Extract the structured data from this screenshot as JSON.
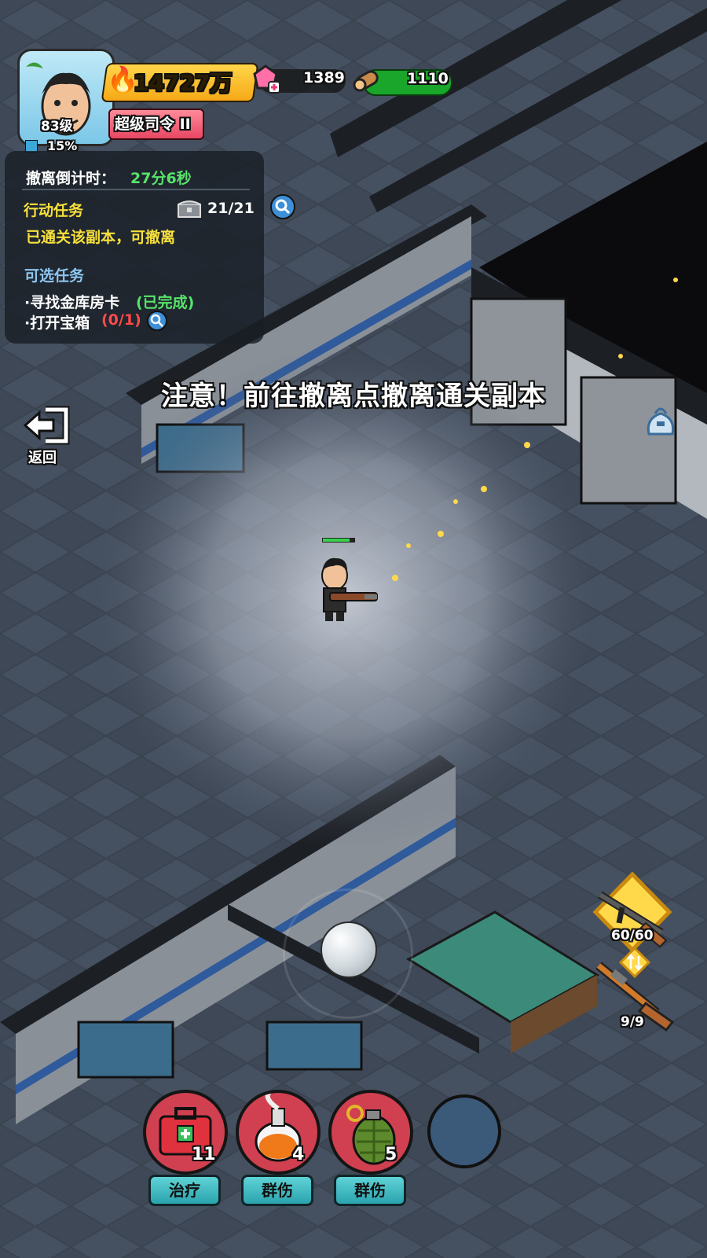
{
  "player": {
    "level": "83级",
    "exp_percent": "15%",
    "rank": "超级司令 II"
  },
  "currency": {
    "power": "14727万",
    "gems": "1389",
    "wood": "1110"
  },
  "mission": {
    "evac_label": "撤离倒计时：",
    "evac_time": "27分6秒",
    "action_title": "行动任务",
    "action_count": "21/21",
    "action_status": "已通关该副本，可撤离",
    "optional_title": "可选任务",
    "task1_name": "·寻找金库房卡",
    "task1_status": "(已完成)",
    "task2_name": "·打开宝箱",
    "task2_progress": "(0/1)"
  },
  "notice": "注意！前往撤离点撤离通关副本",
  "back_label": "返回",
  "weapons": {
    "primary_ammo": "60/60",
    "secondary_ammo": "9/9"
  },
  "skills": [
    {
      "count": "11",
      "label": "治疗",
      "icon": "medkit-icon"
    },
    {
      "count": "4",
      "label": "群伤",
      "icon": "fire-bomb-icon"
    },
    {
      "count": "5",
      "label": "群伤",
      "icon": "grenade-icon"
    }
  ],
  "colors": {
    "accent_yellow": "#f7e03c",
    "success_green": "#58e46a",
    "warning_red": "#ff4a4a",
    "optional_blue": "#8dc6ef"
  }
}
